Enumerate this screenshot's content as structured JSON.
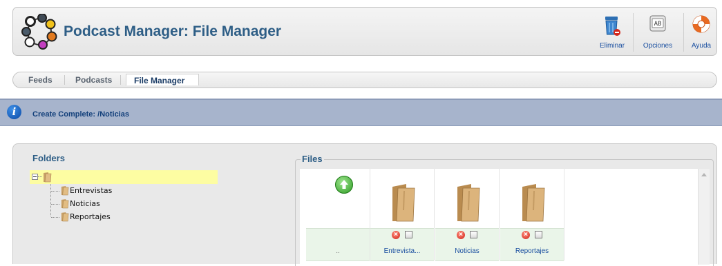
{
  "app": {
    "title": "Podcast Manager: File Manager"
  },
  "toolbar": {
    "delete_label": "Eliminar",
    "options_label": "Opciones",
    "help_label": "Ayuda"
  },
  "tabs": [
    {
      "label": "Feeds",
      "active": false
    },
    {
      "label": "Podcasts",
      "active": false
    },
    {
      "label": "File Manager",
      "active": true
    }
  ],
  "notice": {
    "icon": "info-icon",
    "text": "Create Complete: /Noticias"
  },
  "folders": {
    "title": "Folders",
    "items": [
      {
        "label": "Entrevistas"
      },
      {
        "label": "Noticias"
      },
      {
        "label": "Reportajes"
      }
    ]
  },
  "files": {
    "title": "Files",
    "up_label": "..",
    "items": [
      {
        "label": "Entrevista..."
      },
      {
        "label": "Noticias"
      },
      {
        "label": "Reportajes"
      }
    ]
  },
  "colors": {
    "title_blue": "#2e5e86",
    "info_bar": "#a7b4cc",
    "tree_selected": "#fdfda2"
  }
}
